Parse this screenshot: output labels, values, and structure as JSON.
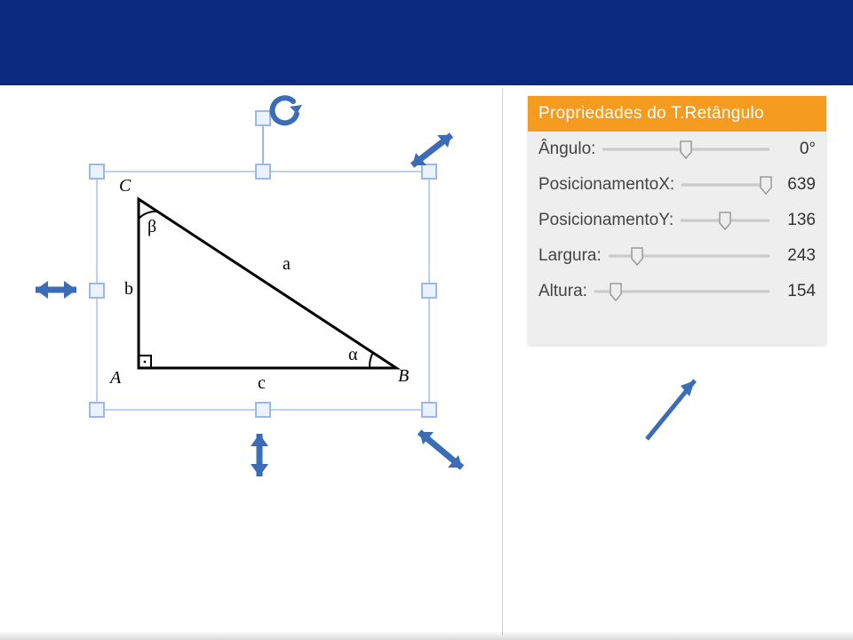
{
  "colors": {
    "accent": "#3a6db5",
    "header": "#0b2a7f",
    "panel_header": "#f59b1f"
  },
  "triangle": {
    "vertex_A": "A",
    "vertex_B": "B",
    "vertex_C": "C",
    "side_a": "a",
    "side_b": "b",
    "side_c": "c",
    "angle_alpha": "α",
    "angle_beta": "β"
  },
  "panel": {
    "title": "Propriedades do T.Retângulo",
    "rows": {
      "angulo": {
        "label": "Ângulo:",
        "value": "0°",
        "thumb_pct": 50
      },
      "posx": {
        "label": "PosicionamentoX:",
        "value": "639",
        "thumb_pct": 96
      },
      "posy": {
        "label": "PosicionamentoY:",
        "value": "136",
        "thumb_pct": 50
      },
      "largura": {
        "label": "Largura:",
        "value": "243",
        "thumb_pct": 18
      },
      "altura": {
        "label": "Altura:",
        "value": "154",
        "thumb_pct": 12
      }
    }
  }
}
